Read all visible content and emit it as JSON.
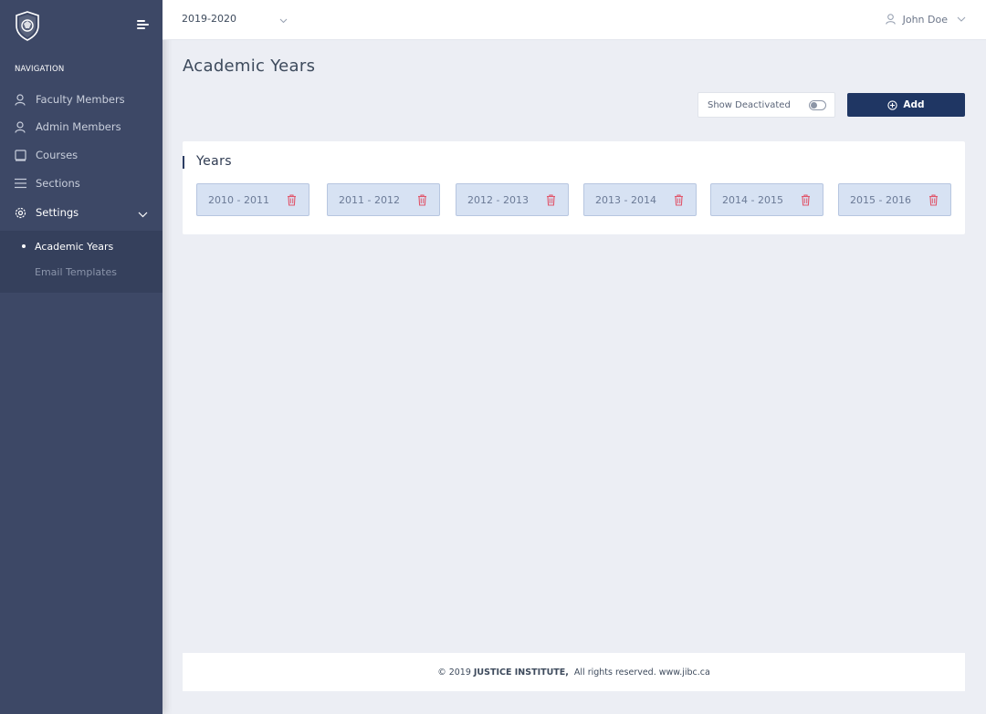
{
  "header": {
    "year_select": "2019-2020",
    "user_name": "John Doe"
  },
  "sidebar": {
    "heading": "NAVIGATION",
    "items": [
      {
        "label": "Faculty Members",
        "icon": "user-icon"
      },
      {
        "label": "Admin Members",
        "icon": "user-icon"
      },
      {
        "label": "Courses",
        "icon": "book-icon"
      },
      {
        "label": "Sections",
        "icon": "list-icon"
      },
      {
        "label": "Settings",
        "icon": "gear-icon"
      }
    ],
    "submenu": [
      {
        "label": "Academic Years",
        "active": true
      },
      {
        "label": "Email Templates",
        "active": false
      }
    ]
  },
  "main": {
    "title": "Academic Years",
    "show_deactivated_label": "Show Deactivated",
    "show_deactivated_on": false,
    "add_label": "Add",
    "card_title": "Years",
    "years": [
      "2010 - 2011",
      "2011 - 2012",
      "2012 - 2013",
      "2013 - 2014",
      "2014 - 2015",
      "2015 - 2016"
    ]
  },
  "footer": {
    "copyright": "© 2019",
    "org": "JUSTICE INSTITUTE,",
    "rights": "All rights reserved. www.jibc.ca"
  },
  "colors": {
    "sidebar": "#3d4866",
    "primary": "#1f3663",
    "chip_bg": "#d7e2f3",
    "trash": "#e0566b"
  }
}
